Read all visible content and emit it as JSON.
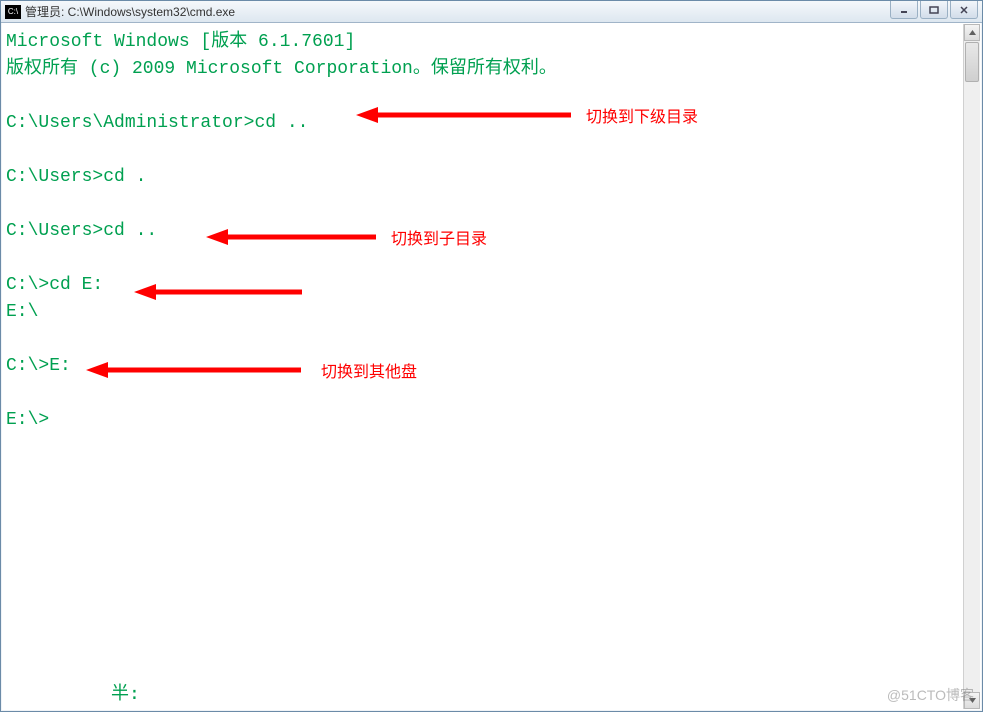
{
  "titlebar": {
    "icon_text": "C:\\",
    "title": "管理员: C:\\Windows\\system32\\cmd.exe"
  },
  "terminal": {
    "line1": "Microsoft Windows [版本 6.1.7601]",
    "line2": "版权所有 (c) 2009 Microsoft Corporation。保留所有权利。",
    "blank": "",
    "prompt1": "C:\\Users\\Administrator>cd ..",
    "prompt2": "C:\\Users>cd .",
    "prompt3": "C:\\Users>cd ..",
    "prompt4": "C:\\>cd E:",
    "output4": "E:\\",
    "prompt5": "C:\\>E:",
    "prompt6": "E:\\>"
  },
  "annotations": {
    "a1": "切换到下级目录",
    "a2": "切换到子目录",
    "a3": "切换到其他盘"
  },
  "bottom_text": "半:",
  "watermark": "@51CTO博客",
  "colors": {
    "terminal_text": "#00a050",
    "annotation": "#ff0000"
  }
}
